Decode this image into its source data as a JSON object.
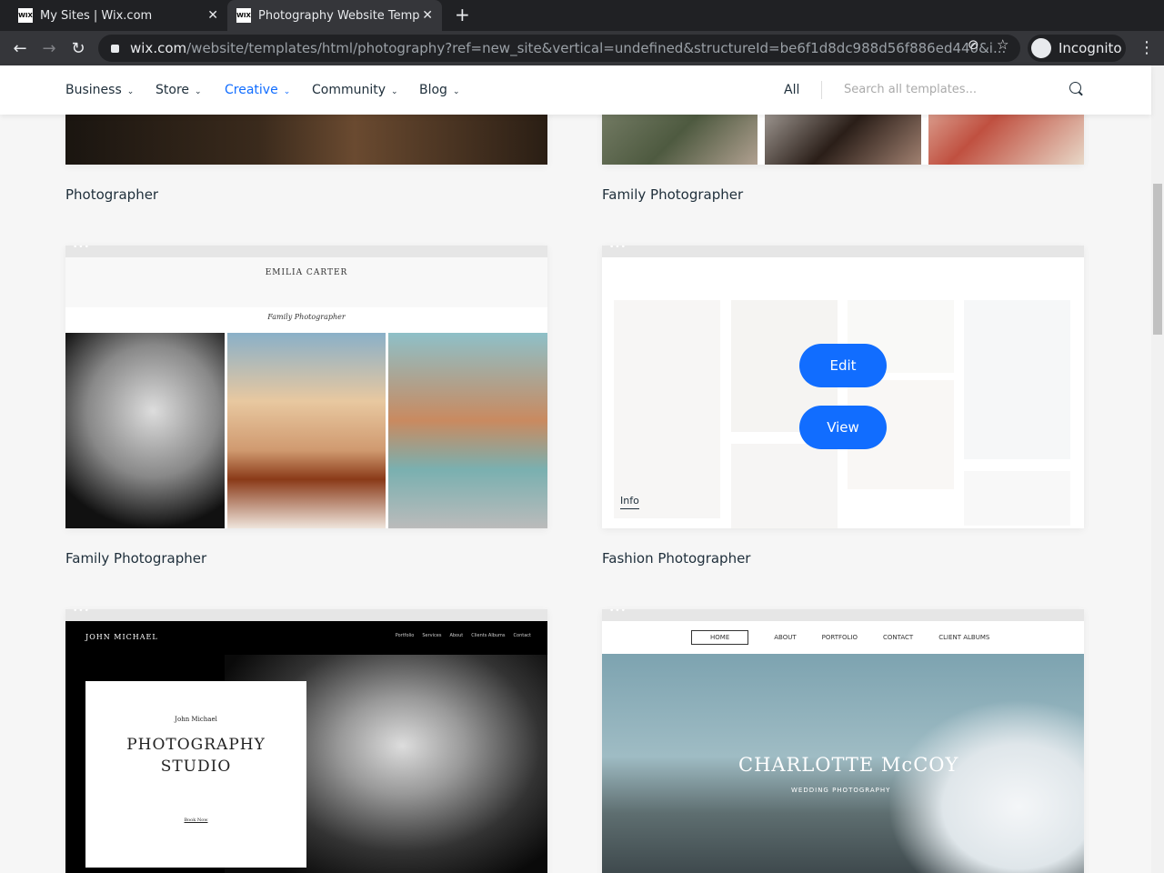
{
  "browser": {
    "tabs": [
      {
        "title": "My Sites | Wix.com",
        "favicon": "WIX"
      },
      {
        "title": "Photography Website Temp",
        "favicon": "WIX"
      }
    ],
    "url_host": "wix.com",
    "url_path": "/website/templates/html/photography?ref=new_site&vertical=undefined&structureId=be6f1d8dc988d56f886ed440&i...",
    "profile": "Incognito"
  },
  "nav": {
    "items": [
      "Business",
      "Store",
      "Creative",
      "Community",
      "Blog"
    ],
    "all": "All",
    "search_placeholder": "Search all templates..."
  },
  "cards": [
    {
      "title": "Photographer"
    },
    {
      "title": "Family Photographer"
    },
    {
      "title": "Family Photographer",
      "thumb": {
        "name": "EMILIA CARTER",
        "subtitle": "Family Photographer"
      }
    },
    {
      "title": "Fashion Photographer",
      "edit": "Edit",
      "view": "View",
      "info": "Info"
    },
    {
      "thumb": {
        "name": "JOHN MICHAEL",
        "small": "John Michael",
        "line1": "PHOTOGRAPHY",
        "line2": "STUDIO",
        "cta": "Book Now",
        "menu": [
          "Portfolio",
          "Services",
          "About",
          "Clients Albums",
          "Contact"
        ]
      }
    },
    {
      "thumb": {
        "name": "CHARLOTTE McCOY",
        "subtitle": "WEDDING PHOTOGRAPHY",
        "menu": [
          "HOME",
          "ABOUT",
          "PORTFOLIO",
          "CONTACT",
          "CLIENT ALBUMS"
        ]
      }
    }
  ]
}
